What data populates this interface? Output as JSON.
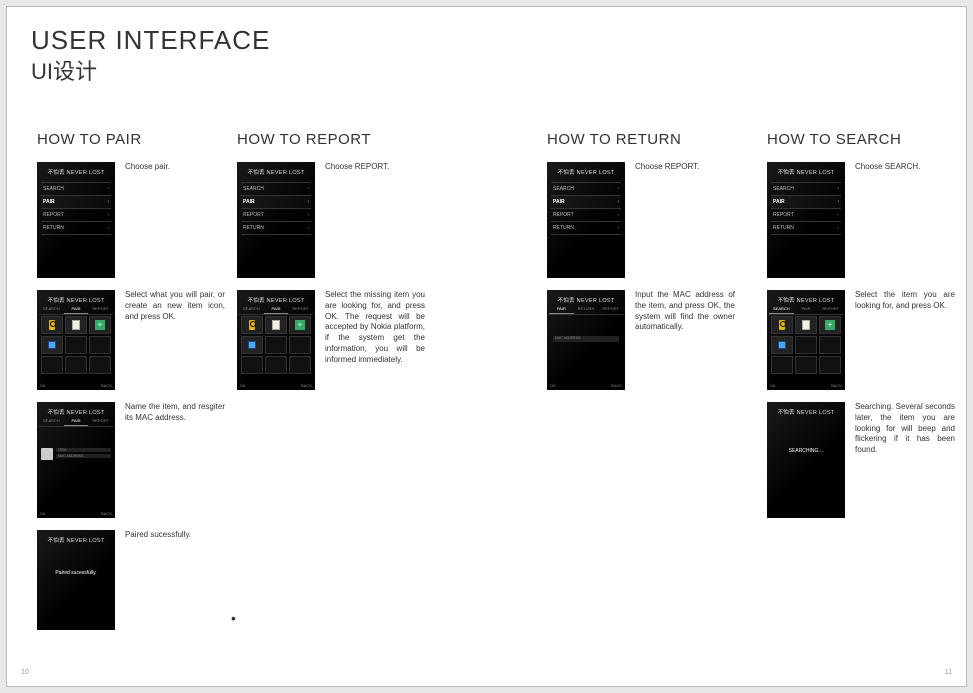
{
  "title": {
    "en": "USER INTERFACE",
    "cn": "UI设计"
  },
  "app_title": "不怕丢 NEVER LOST",
  "menu": {
    "search": "SEARCH",
    "pair": "PAIR",
    "report": "REPORT",
    "return": "RETURN"
  },
  "tabs": {
    "search": "SEARCH",
    "pair": "PAIR",
    "report": "REPORT",
    "return": "RETURN"
  },
  "softkeys": {
    "ok": "OK",
    "back": "BACK"
  },
  "form": {
    "item": "ITEM",
    "mac": "MAC ADDRESS"
  },
  "columns": {
    "pair": {
      "heading": "HOW TO PAIR",
      "steps": [
        "Choose pair.",
        "Select what you will pair, or create an new item icon, and press OK.",
        "Name the item, and resgiter its MAC address.",
        "Paired sucessfully."
      ],
      "success_msg": "Paired sucessfully."
    },
    "report": {
      "heading": "HOW TO REPORT",
      "steps": [
        "Choose REPORT.",
        "Select the missing item you are looking for, and press OK. The request will be accepted by Nokia platform, if the system get the information, you will be informed immediately."
      ]
    },
    "return": {
      "heading": "HOW TO RETURN",
      "steps": [
        "Choose REPORT.",
        "Input the MAC address of the item, and press OK, the system will find the owner automatically."
      ]
    },
    "search": {
      "heading": "HOW TO SEARCH",
      "steps": [
        "Choose SEARCH.",
        "Select the item you are looking for, and press OK.",
        "Searching. Several seconds later, the item you are looking for will beep and flickering if it has been found."
      ],
      "searching_msg": "SEARCHING…"
    }
  },
  "pagenum": {
    "left": "10",
    "right": "11"
  }
}
